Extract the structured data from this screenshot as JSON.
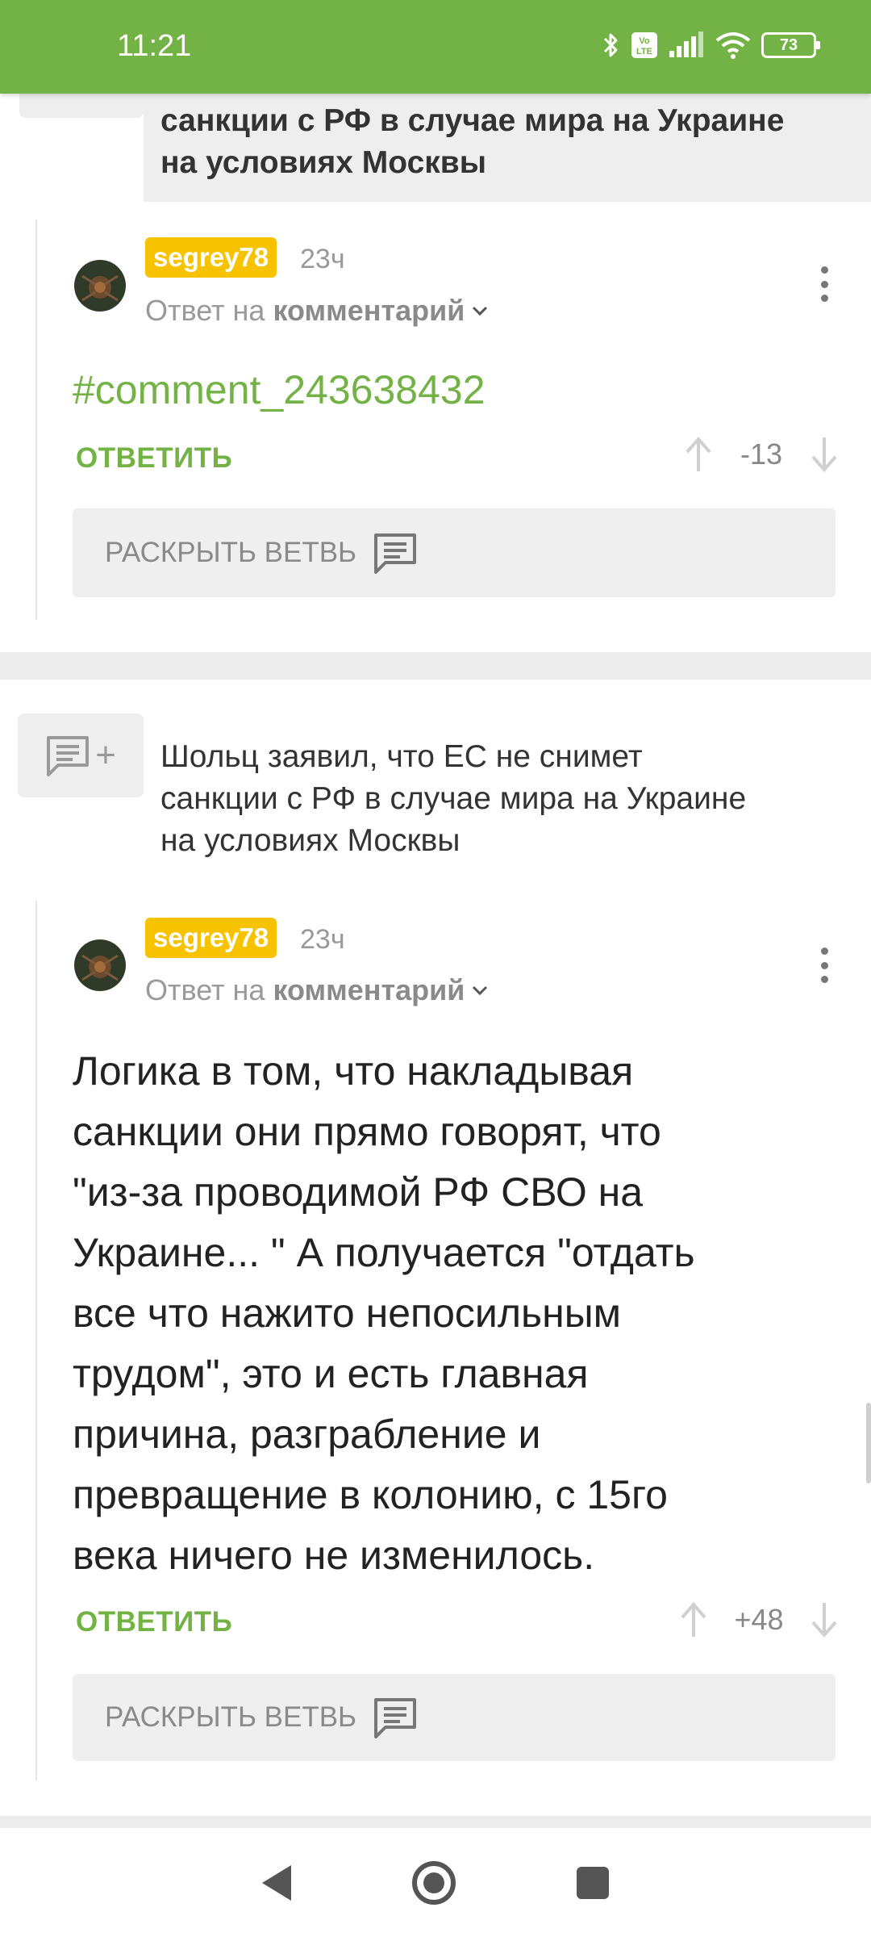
{
  "status_bar": {
    "time": "11:21",
    "battery": "73",
    "icons": [
      "bluetooth-icon",
      "volte-icon",
      "signal-icon",
      "wifi-icon",
      "battery-icon"
    ],
    "network_badge": "Vo LTE"
  },
  "colors": {
    "accent": "#73b244",
    "username_bg": "#f7c300",
    "status_bar": "#73b244"
  },
  "top_post": {
    "title_line1": "санкции с РФ в случае мира на Украине",
    "title_line2": "на условиях Москвы"
  },
  "comment1": {
    "username": "segrey78",
    "time": "23ч",
    "reply_prefix": "Ответ на",
    "reply_target": "комментарий",
    "link_text": "#comment_243638432",
    "reply_label": "ОТВЕТИТЬ",
    "score": "-13",
    "expand_label": "РАСКРЫТЬ ВЕТВЬ"
  },
  "post2": {
    "title_line1": "Шольц заявил, что ЕС не снимет",
    "title_line2": "санкции с РФ в случае мира на Украине",
    "title_line3": "на условиях Москвы"
  },
  "comment2": {
    "username": "segrey78",
    "time": "23ч",
    "reply_prefix": "Ответ на",
    "reply_target": "комментарий",
    "text": "Логика в том, что накладывая\nсанкции они прямо говорят, что\n\"из-за проводимой РФ СВО на\nУкраине... \" А получается \"отдать\nвсе что нажито непосильным\nтрудом\", это и есть главная\nпричина, разграбление и\nпревращение в колонию, с 15го\nвека ничего не изменилось.",
    "reply_label": "ОТВЕТИТЬ",
    "score": "+48",
    "expand_label": "РАСКРЫТЬ ВЕТВЬ"
  },
  "nav": {
    "icons": [
      "back-icon",
      "home-icon",
      "recents-icon"
    ]
  }
}
